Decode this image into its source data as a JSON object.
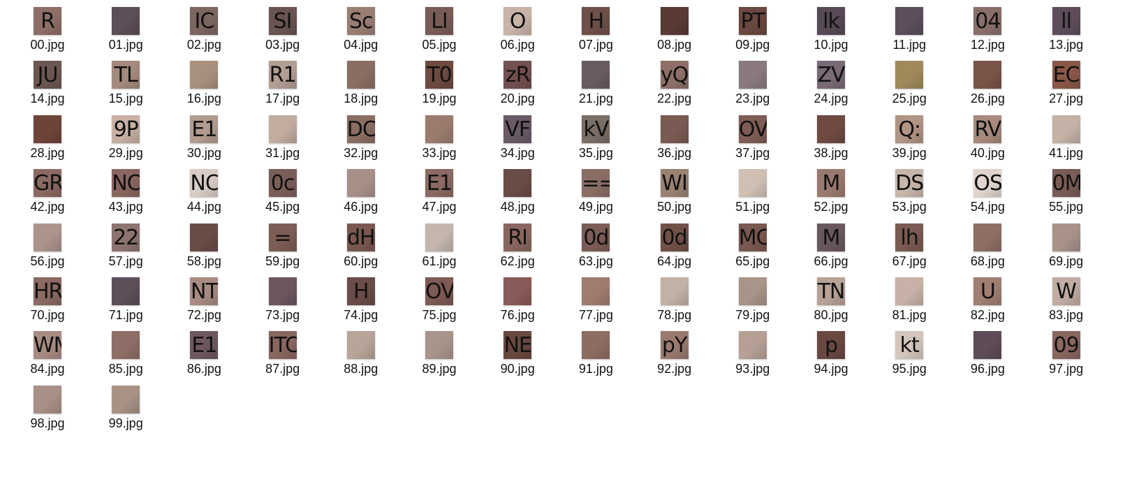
{
  "files": [
    {
      "name": "00.jpg",
      "glyph": "R",
      "color": "#8e6e67"
    },
    {
      "name": "01.jpg",
      "glyph": "",
      "color": "#5e4e58"
    },
    {
      "name": "02.jpg",
      "glyph": "IC",
      "color": "#7c6660"
    },
    {
      "name": "03.jpg",
      "glyph": "SI",
      "color": "#6a5450"
    },
    {
      "name": "04.jpg",
      "glyph": "Sc",
      "color": "#9a7e74"
    },
    {
      "name": "05.jpg",
      "glyph": "LI",
      "color": "#7a5c56"
    },
    {
      "name": "06.jpg",
      "glyph": "O",
      "color": "#c7b3a8"
    },
    {
      "name": "07.jpg",
      "glyph": "H",
      "color": "#6e5048"
    },
    {
      "name": "08.jpg",
      "glyph": "",
      "color": "#5a3a34"
    },
    {
      "name": "09.jpg",
      "glyph": "PT",
      "color": "#6a4840"
    },
    {
      "name": "10.jpg",
      "glyph": "lk",
      "color": "#574a56"
    },
    {
      "name": "11.jpg",
      "glyph": "",
      "color": "#5c4e5c"
    },
    {
      "name": "12.jpg",
      "glyph": "04",
      "color": "#8a6e6a"
    },
    {
      "name": "13.jpg",
      "glyph": "ll",
      "color": "#5e4c5a"
    },
    {
      "name": "14.jpg",
      "glyph": "JU",
      "color": "#6d5752"
    },
    {
      "name": "15.jpg",
      "glyph": "TL",
      "color": "#a48a7c"
    },
    {
      "name": "16.jpg",
      "glyph": "",
      "color": "#a8907e"
    },
    {
      "name": "17.jpg",
      "glyph": "R1",
      "color": "#b39e94"
    },
    {
      "name": "18.jpg",
      "glyph": "",
      "color": "#8a6e62"
    },
    {
      "name": "19.jpg",
      "glyph": "T0",
      "color": "#6e4a40"
    },
    {
      "name": "20.jpg",
      "glyph": "zR",
      "color": "#745050"
    },
    {
      "name": "21.jpg",
      "glyph": "",
      "color": "#6a5a62"
    },
    {
      "name": "22.jpg",
      "glyph": "yQ",
      "color": "#8e7068"
    },
    {
      "name": "23.jpg",
      "glyph": "",
      "color": "#8a7a80"
    },
    {
      "name": "24.jpg",
      "glyph": "ZV",
      "color": "#7a6a76"
    },
    {
      "name": "25.jpg",
      "glyph": "",
      "color": "#a08a5c"
    },
    {
      "name": "26.jpg",
      "glyph": "",
      "color": "#7a5448"
    },
    {
      "name": "27.jpg",
      "glyph": "EC",
      "color": "#8a5848"
    },
    {
      "name": "28.jpg",
      "glyph": "",
      "color": "#6e4438"
    },
    {
      "name": "29.jpg",
      "glyph": "9P",
      "color": "#c8b0a4"
    },
    {
      "name": "30.jpg",
      "glyph": "E1",
      "color": "#b29c90"
    },
    {
      "name": "31.jpg",
      "glyph": "",
      "color": "#c2aca0"
    },
    {
      "name": "32.jpg",
      "glyph": "DC",
      "color": "#8a6e62"
    },
    {
      "name": "33.jpg",
      "glyph": "",
      "color": "#9a7c6e"
    },
    {
      "name": "34.jpg",
      "glyph": "VF",
      "color": "#6a5a66"
    },
    {
      "name": "35.jpg",
      "glyph": "kV",
      "color": "#7a6e66"
    },
    {
      "name": "36.jpg",
      "glyph": "",
      "color": "#7a5a52"
    },
    {
      "name": "37.jpg",
      "glyph": "OV",
      "color": "#805c56"
    },
    {
      "name": "38.jpg",
      "glyph": "",
      "color": "#6e4a42"
    },
    {
      "name": "39.jpg",
      "glyph": "Q:",
      "color": "#b09484"
    },
    {
      "name": "40.jpg",
      "glyph": "RV",
      "color": "#a88a7c"
    },
    {
      "name": "41.jpg",
      "glyph": "",
      "color": "#c4b2a6"
    },
    {
      "name": "42.jpg",
      "glyph": "GR",
      "color": "#8a6a62"
    },
    {
      "name": "43.jpg",
      "glyph": "NC",
      "color": "#8a6660"
    },
    {
      "name": "44.jpg",
      "glyph": "NC",
      "color": "#d8ccc4"
    },
    {
      "name": "45.jpg",
      "glyph": "0c",
      "color": "#7c5e58"
    },
    {
      "name": "46.jpg",
      "glyph": "",
      "color": "#a89088"
    },
    {
      "name": "47.jpg",
      "glyph": "E1",
      "color": "#8a6a62"
    },
    {
      "name": "48.jpg",
      "glyph": "",
      "color": "#6a4c46"
    },
    {
      "name": "49.jpg",
      "glyph": "==",
      "color": "#8a6e66"
    },
    {
      "name": "50.jpg",
      "glyph": "WI",
      "color": "#9a8272"
    },
    {
      "name": "51.jpg",
      "glyph": "",
      "color": "#d0c0b4"
    },
    {
      "name": "52.jpg",
      "glyph": "M",
      "color": "#9a7a70"
    },
    {
      "name": "53.jpg",
      "glyph": "DS",
      "color": "#c8b6aa"
    },
    {
      "name": "54.jpg",
      "glyph": "OS",
      "color": "#e0d4cc"
    },
    {
      "name": "55.jpg",
      "glyph": "0M",
      "color": "#7a5c56"
    },
    {
      "name": "56.jpg",
      "glyph": "",
      "color": "#ab948c"
    },
    {
      "name": "57.jpg",
      "glyph": "22",
      "color": "#8e7470"
    },
    {
      "name": "58.jpg",
      "glyph": "",
      "color": "#6a4c46"
    },
    {
      "name": "59.jpg",
      "glyph": "=",
      "color": "#7c5c54"
    },
    {
      "name": "60.jpg",
      "glyph": "dH",
      "color": "#7a5850"
    },
    {
      "name": "61.jpg",
      "glyph": "",
      "color": "#c4b6ac"
    },
    {
      "name": "62.jpg",
      "glyph": "RI",
      "color": "#8a6660"
    },
    {
      "name": "63.jpg",
      "glyph": "0d",
      "color": "#7c5c56"
    },
    {
      "name": "64.jpg",
      "glyph": "0d",
      "color": "#725048"
    },
    {
      "name": "65.jpg",
      "glyph": "MC",
      "color": "#7a5850"
    },
    {
      "name": "66.jpg",
      "glyph": "M",
      "color": "#6a5860"
    },
    {
      "name": "67.jpg",
      "glyph": "lh",
      "color": "#7a5a52"
    },
    {
      "name": "68.jpg",
      "glyph": "",
      "color": "#8e6e64"
    },
    {
      "name": "69.jpg",
      "glyph": "",
      "color": "#a8928a"
    },
    {
      "name": "70.jpg",
      "glyph": "HR",
      "color": "#8a6a62"
    },
    {
      "name": "71.jpg",
      "glyph": "",
      "color": "#5e4e5a"
    },
    {
      "name": "72.jpg",
      "glyph": "NT",
      "color": "#a88c82"
    },
    {
      "name": "73.jpg",
      "glyph": "",
      "color": "#6c5660"
    },
    {
      "name": "74.jpg",
      "glyph": "H",
      "color": "#6a4c48"
    },
    {
      "name": "75.jpg",
      "glyph": "OV",
      "color": "#7e5a54"
    },
    {
      "name": "76.jpg",
      "glyph": "",
      "color": "#8a5a58"
    },
    {
      "name": "77.jpg",
      "glyph": "",
      "color": "#a07c70"
    },
    {
      "name": "78.jpg",
      "glyph": "",
      "color": "#c2b2a6"
    },
    {
      "name": "79.jpg",
      "glyph": "",
      "color": "#a89488"
    },
    {
      "name": "80.jpg",
      "glyph": "TN",
      "color": "#b8a296"
    },
    {
      "name": "81.jpg",
      "glyph": "",
      "color": "#c8b2a8"
    },
    {
      "name": "82.jpg",
      "glyph": "U",
      "color": "#a07e72"
    },
    {
      "name": "83.jpg",
      "glyph": "W",
      "color": "#c0aca2"
    },
    {
      "name": "84.jpg",
      "glyph": "WM",
      "color": "#a88c82"
    },
    {
      "name": "85.jpg",
      "glyph": "",
      "color": "#8e6e66"
    },
    {
      "name": "86.jpg",
      "glyph": "E1",
      "color": "#6e5860"
    },
    {
      "name": "87.jpg",
      "glyph": "ITC",
      "color": "#8a6660"
    },
    {
      "name": "88.jpg",
      "glyph": "",
      "color": "#b8a498"
    },
    {
      "name": "89.jpg",
      "glyph": "",
      "color": "#a8948a"
    },
    {
      "name": "90.jpg",
      "glyph": "NE",
      "color": "#6a4840"
    },
    {
      "name": "91.jpg",
      "glyph": "",
      "color": "#8e6c62"
    },
    {
      "name": "92.jpg",
      "glyph": "pY",
      "color": "#9a7a6e"
    },
    {
      "name": "93.jpg",
      "glyph": "",
      "color": "#b6a096"
    },
    {
      "name": "94.jpg",
      "glyph": "p",
      "color": "#6a4842"
    },
    {
      "name": "95.jpg",
      "glyph": "kt",
      "color": "#d4c6bc"
    },
    {
      "name": "96.jpg",
      "glyph": "",
      "color": "#5e4c58"
    },
    {
      "name": "97.jpg",
      "glyph": "09",
      "color": "#8a6660"
    },
    {
      "name": "98.jpg",
      "glyph": "",
      "color": "#a89086"
    },
    {
      "name": "99.jpg",
      "glyph": "",
      "color": "#a89286"
    }
  ]
}
